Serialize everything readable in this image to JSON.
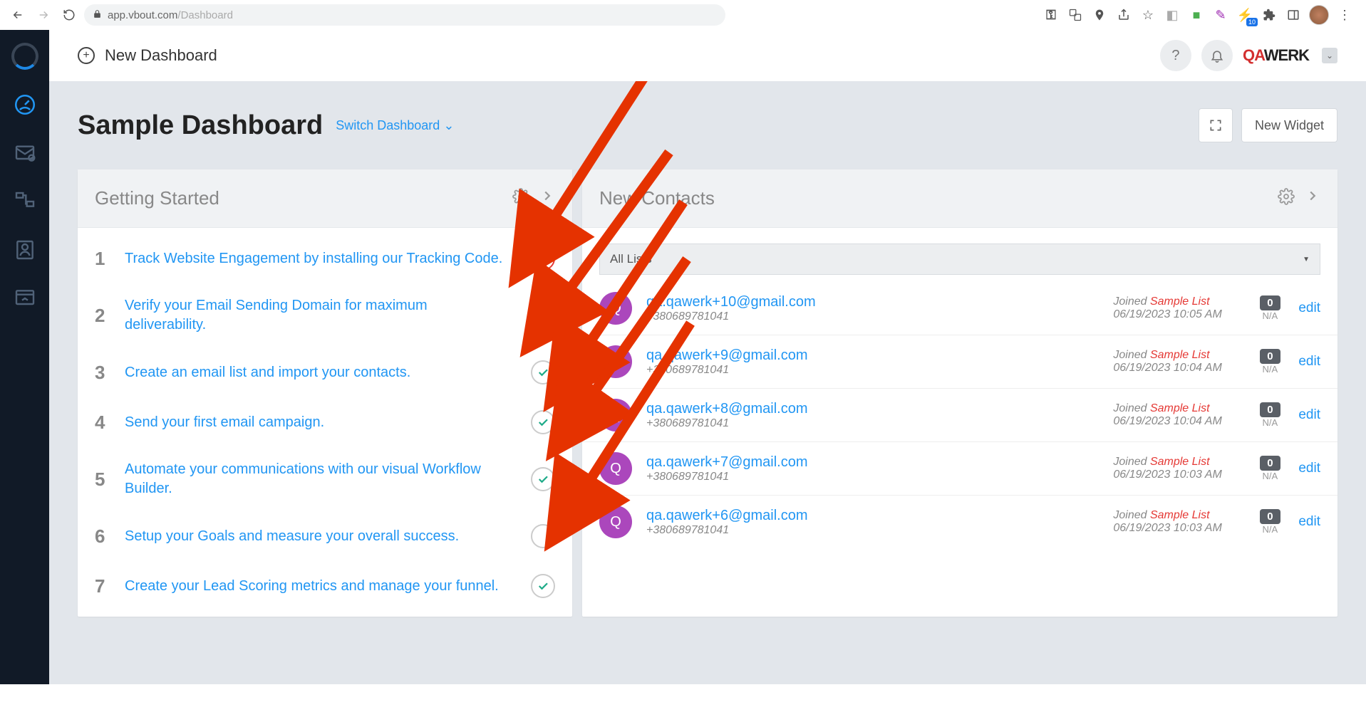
{
  "browser": {
    "url_host": "app.vbout.com",
    "url_path": "/Dashboard",
    "ext_badge": "10"
  },
  "topbar": {
    "new_dashboard": "New Dashboard"
  },
  "header": {
    "title": "Sample Dashboard",
    "switch": "Switch Dashboard",
    "new_widget": "New Widget"
  },
  "getting_started": {
    "title": "Getting Started",
    "steps": [
      {
        "num": "1",
        "text": "Track Website Engagement by installing our Tracking Code.",
        "status": "fail"
      },
      {
        "num": "2",
        "text": "Verify your Email Sending Domain for maximum deliverability.",
        "status": "empty"
      },
      {
        "num": "3",
        "text": "Create an email list and import your contacts.",
        "status": "done"
      },
      {
        "num": "4",
        "text": "Send your first email campaign.",
        "status": "done"
      },
      {
        "num": "5",
        "text": "Automate your communications with our visual Workflow Builder.",
        "status": "done"
      },
      {
        "num": "6",
        "text": "Setup your Goals and measure your overall success.",
        "status": "empty"
      },
      {
        "num": "7",
        "text": "Create your Lead Scoring metrics and manage your funnel.",
        "status": "done"
      }
    ]
  },
  "new_contacts": {
    "title": "New Contacts",
    "filter": "All Lists",
    "joined_label": "Joined",
    "list_name": "Sample List",
    "na": "N/A",
    "edit": "edit",
    "rows": [
      {
        "initial": "Q",
        "email": "qa.qawerk+10@gmail.com",
        "phone": "+380689781041",
        "date": "06/19/2023 10:05 AM",
        "count": "0"
      },
      {
        "initial": "Q",
        "email": "qa.qawerk+9@gmail.com",
        "phone": "+380689781041",
        "date": "06/19/2023 10:04 AM",
        "count": "0"
      },
      {
        "initial": "Q",
        "email": "qa.qawerk+8@gmail.com",
        "phone": "+380689781041",
        "date": "06/19/2023 10:04 AM",
        "count": "0"
      },
      {
        "initial": "Q",
        "email": "qa.qawerk+7@gmail.com",
        "phone": "+380689781041",
        "date": "06/19/2023 10:03 AM",
        "count": "0"
      },
      {
        "initial": "Q",
        "email": "qa.qawerk+6@gmail.com",
        "phone": "+380689781041",
        "date": "06/19/2023 10:03 AM",
        "count": "0"
      }
    ]
  }
}
